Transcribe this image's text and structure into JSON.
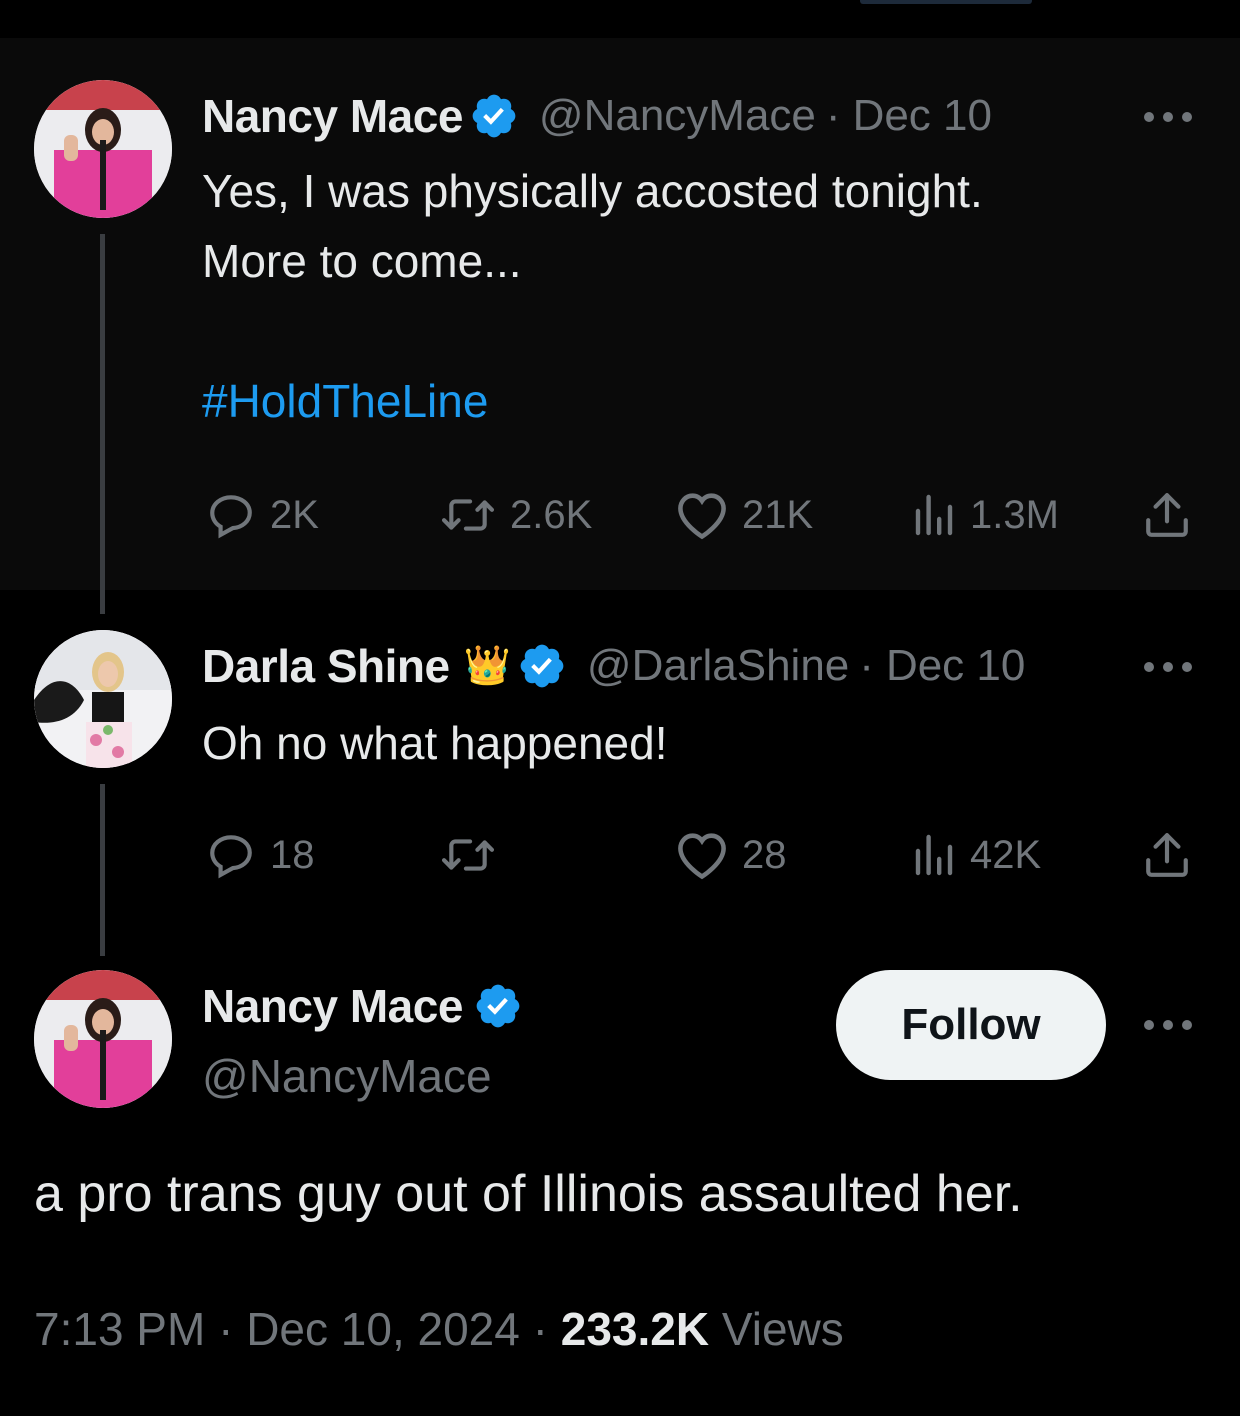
{
  "tweet1": {
    "name": "Nancy Mace",
    "handle": "@NancyMace",
    "date": "Dec 10",
    "separator": "·",
    "text": "Yes, I was physically accosted tonight.\nMore to come...",
    "hashtag": "#HoldTheLine",
    "stats": {
      "replies": "2K",
      "reposts": "2.6K",
      "likes": "21K",
      "views": "1.3M"
    }
  },
  "tweet2": {
    "name": "Darla Shine",
    "badge_emoji": "👑",
    "handle": "@DarlaShine",
    "date": "Dec 10",
    "separator": "·",
    "text": "Oh no what happened!",
    "stats": {
      "replies": "18",
      "reposts": "",
      "likes": "28",
      "views": "42K"
    }
  },
  "main_tweet": {
    "name": "Nancy Mace",
    "handle": "@NancyMace",
    "follow_label": "Follow",
    "text": "a pro trans guy out of Illinois assaulted her.",
    "time": "7:13 PM",
    "date": "Dec 10, 2024",
    "separator": "·",
    "views_count": "233.2K",
    "views_label": "Views"
  },
  "colors": {
    "background": "#000000",
    "text": "#e7e9ea",
    "muted": "#71767b",
    "accent": "#1d9bf0",
    "verified": "#1d9bf0"
  },
  "icons": [
    "verified-badge-icon",
    "more-icon",
    "reply-icon",
    "repost-icon",
    "like-icon",
    "views-icon",
    "share-icon"
  ]
}
